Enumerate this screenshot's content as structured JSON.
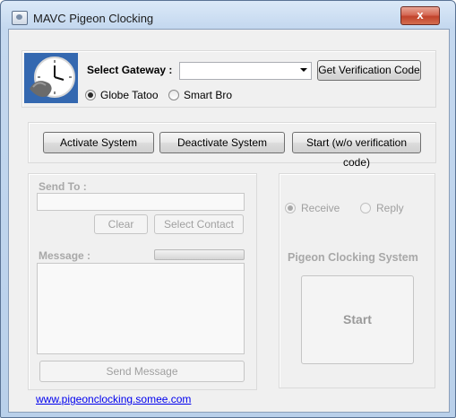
{
  "window": {
    "title": "MAVC Pigeon Clocking",
    "close_label": "x"
  },
  "gateway": {
    "label": "Select Gateway :",
    "selected": "",
    "verify_button": "Get Verification Code",
    "options": [
      {
        "label": "Globe Tatoo",
        "checked": true
      },
      {
        "label": "Smart Bro",
        "checked": false
      }
    ]
  },
  "system": {
    "activate": "Activate System",
    "deactivate": "Deactivate System",
    "start_no_verify": "Start (w/o verification code)"
  },
  "send": {
    "to_label": "Send To :",
    "to_value": "",
    "clear": "Clear",
    "select_contact": "Select Contact",
    "message_label": "Message :",
    "message_value": "",
    "send_button": "Send Message"
  },
  "clocking": {
    "receive": "Receive",
    "reply": "Reply",
    "system_label": "Pigeon Clocking System",
    "start": "Start"
  },
  "footer": {
    "link": "www.pigeonclocking.somee.com"
  },
  "colors": {
    "titlebar": "#c4d8ef",
    "close": "#c1432c",
    "link": "#0000ee"
  }
}
